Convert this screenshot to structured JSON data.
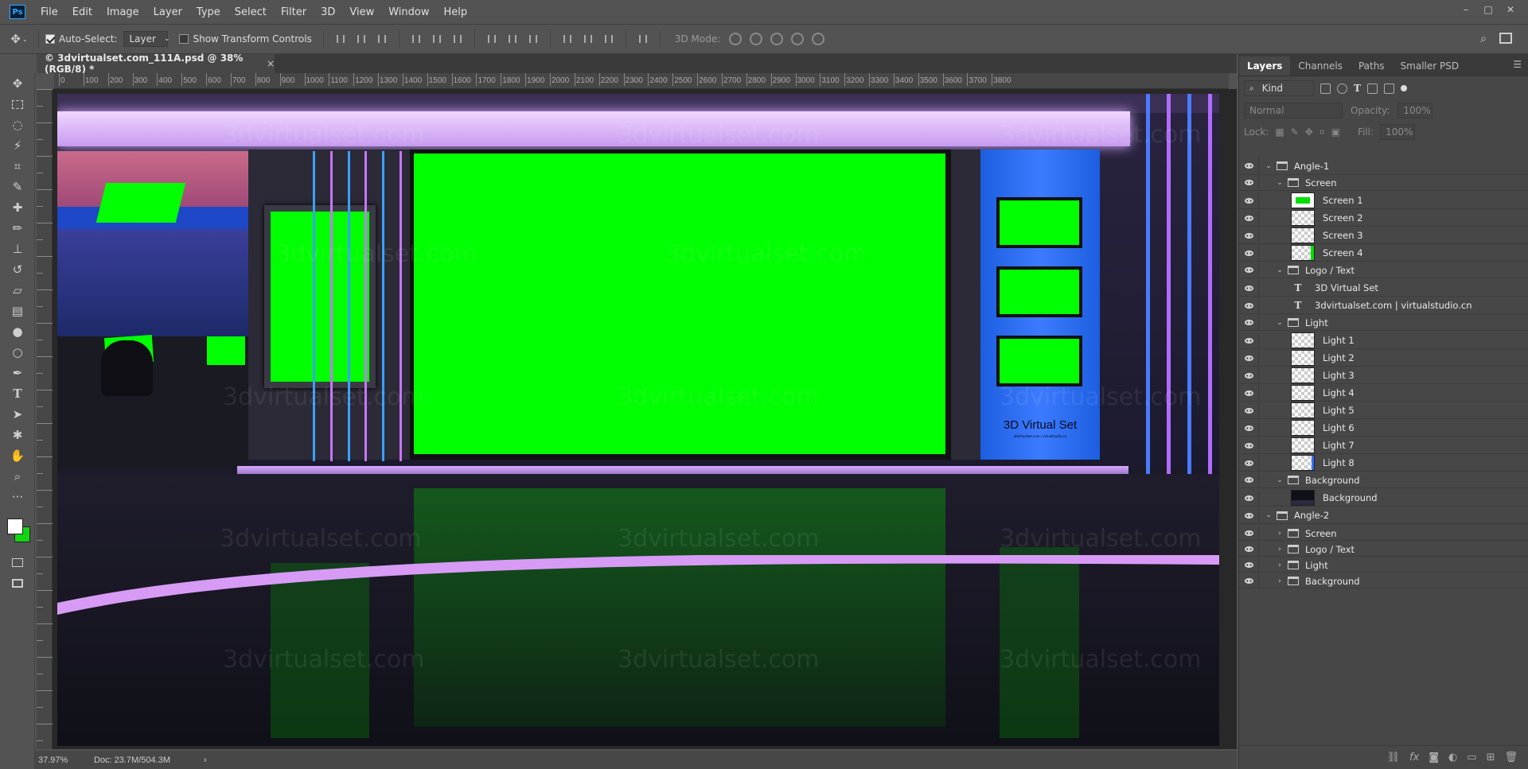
{
  "app": {
    "logo": "Ps"
  },
  "menu": [
    "File",
    "Edit",
    "Image",
    "Layer",
    "Type",
    "Select",
    "Filter",
    "3D",
    "View",
    "Window",
    "Help"
  ],
  "window_controls": {
    "minimize": "–",
    "maximize": "□",
    "close": "✕"
  },
  "options": {
    "auto_select_label": "Auto-Select:",
    "auto_select_value": "Layer",
    "show_transform_label": "Show Transform Controls",
    "threed_mode_label": "3D Mode:"
  },
  "document": {
    "tab_title": "© 3dvirtualset.com_111A.psd @ 38% (RGB/8) *",
    "tab_close": "×"
  },
  "ruler_top": [
    "0",
    "100",
    "200",
    "300",
    "400",
    "500",
    "600",
    "700",
    "800",
    "900",
    "1000",
    "1100",
    "1200",
    "1300",
    "1400",
    "1500",
    "1600",
    "1700",
    "1800",
    "1900",
    "2000",
    "2100",
    "2200",
    "2300",
    "2400",
    "2500",
    "2600",
    "2700",
    "2800",
    "2900",
    "3000",
    "3100",
    "3200",
    "3300",
    "3400",
    "3500",
    "3600",
    "3700",
    "3800"
  ],
  "scene": {
    "panel_logo_title": "3D Virtual Set",
    "panel_logo_sub": "3dvirtualset.com | virtualstudio.cn"
  },
  "watermark": "3dvirtualset.com",
  "status": {
    "zoom": "37.97%",
    "doc": "Doc: 23.7M/504.3M",
    "arrow": "›"
  },
  "panel": {
    "tabs": [
      "Layers",
      "Channels",
      "Paths",
      "Smaller PSD"
    ],
    "filter_label": "Kind",
    "blend_mode": "Normal",
    "opacity_label": "Opacity:",
    "opacity_value": "100%",
    "lock_label": "Lock:",
    "fill_label": "Fill:",
    "fill_value": "100%"
  },
  "layers": [
    {
      "name": "Angle-1",
      "type": "group",
      "indent": 0,
      "open": true
    },
    {
      "name": "Screen",
      "type": "group",
      "indent": 1,
      "open": true
    },
    {
      "name": "Screen 1",
      "type": "layer",
      "indent": 2,
      "thumb": "green"
    },
    {
      "name": "Screen 2",
      "type": "layer",
      "indent": 2,
      "thumb": "check"
    },
    {
      "name": "Screen 3",
      "type": "layer",
      "indent": 2,
      "thumb": "check"
    },
    {
      "name": "Screen 4",
      "type": "layer",
      "indent": 2,
      "thumb": "greendot"
    },
    {
      "name": "Logo / Text",
      "type": "group",
      "indent": 1,
      "open": true
    },
    {
      "name": "3D Virtual Set",
      "type": "text",
      "indent": 2
    },
    {
      "name": "3dvirtualset.com | virtualstudio.cn",
      "type": "text",
      "indent": 2
    },
    {
      "name": "Light",
      "type": "group",
      "indent": 1,
      "open": true
    },
    {
      "name": "Light 1",
      "type": "layer",
      "indent": 2,
      "thumb": "check"
    },
    {
      "name": "Light 2",
      "type": "layer",
      "indent": 2,
      "thumb": "check"
    },
    {
      "name": "Light 3",
      "type": "layer",
      "indent": 2,
      "thumb": "check"
    },
    {
      "name": "Light 4",
      "type": "layer",
      "indent": 2,
      "thumb": "check"
    },
    {
      "name": "Light 5",
      "type": "layer",
      "indent": 2,
      "thumb": "check"
    },
    {
      "name": "Light 6",
      "type": "layer",
      "indent": 2,
      "thumb": "check"
    },
    {
      "name": "Light 7",
      "type": "layer",
      "indent": 2,
      "thumb": "check"
    },
    {
      "name": "Light 8",
      "type": "layer",
      "indent": 2,
      "thumb": "checkblue"
    },
    {
      "name": "Background",
      "type": "group",
      "indent": 1,
      "open": true
    },
    {
      "name": "Background",
      "type": "layer",
      "indent": 2,
      "thumb": "dark"
    },
    {
      "name": "Angle-2",
      "type": "group",
      "indent": 0,
      "open": true
    },
    {
      "name": "Screen",
      "type": "group",
      "indent": 1,
      "open": false
    },
    {
      "name": "Logo / Text",
      "type": "group",
      "indent": 1,
      "open": false
    },
    {
      "name": "Light",
      "type": "group",
      "indent": 1,
      "open": false
    },
    {
      "name": "Background",
      "type": "group",
      "indent": 1,
      "open": false
    }
  ]
}
